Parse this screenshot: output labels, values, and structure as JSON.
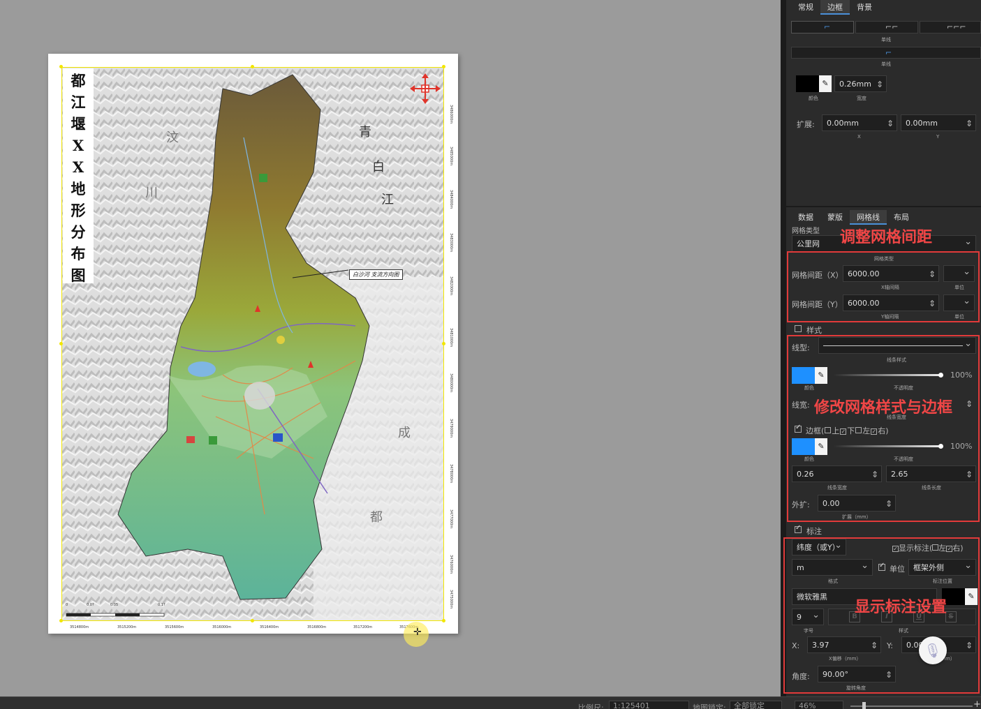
{
  "map": {
    "title_chars": [
      "都",
      "江",
      "堰",
      "X",
      "X",
      "地",
      "形",
      "分",
      "布",
      "图"
    ],
    "labels": {
      "wen": "汶",
      "chuan": "川",
      "qing": "青",
      "bai": "白",
      "jiang": "江",
      "cheng": "成",
      "du": "都"
    },
    "callout": "白沙河 支流方向图",
    "bottom_coords": [
      "3514800m",
      "3515200m",
      "3515600m",
      "3516000m",
      "3516400m",
      "3516800m",
      "3517200m",
      "3517600m"
    ],
    "right_coords": [
      "3486000m",
      "3485000m",
      "3484000m",
      "3483000m",
      "3482000m",
      "3481000m",
      "3480000m",
      "3479000m",
      "3478000m",
      "3477000m",
      "3476000m",
      "3475000m"
    ],
    "scale_ticks": [
      "0",
      "0.0?",
      "0.05",
      "0.1?"
    ]
  },
  "top_tabs": [
    "常规",
    "边框",
    "背景"
  ],
  "border": {
    "style1_label": "单线",
    "style2_label": "单线",
    "color": "#000000",
    "color_label": "颜色",
    "width_value": "0.26mm",
    "width_label": "宽度",
    "expand_label": "扩展:",
    "expand_x": "0.00mm",
    "expand_y": "0.00mm",
    "x_label": "X",
    "y_label": "Y"
  },
  "sub_tabs": [
    "数据",
    "蒙版",
    "网格线",
    "布局"
  ],
  "grid": {
    "type_label": "网格类型",
    "type_value": "公里网",
    "type_caption": "网格类型",
    "x_label": "网格间距（X）",
    "x_value": "6000.00",
    "x_caption": "X轴间隔",
    "y_label": "网格间距（Y）",
    "y_value": "6000.00",
    "y_caption": "Y轴间隔",
    "unit_caption": "单位"
  },
  "style": {
    "section_label": "样式",
    "line_type_label": "线型:",
    "line_type_caption": "线条样式",
    "line_color": "#1e90ff",
    "color_caption": "颜色",
    "opacity_caption": "不透明度",
    "opacity_value": "100%",
    "line_width_label": "线宽:",
    "line_width_caption": "线条宽度",
    "border_label": "边框(",
    "border_top": "上",
    "border_bottom": "下",
    "border_left": "左",
    "border_right": "右",
    "border_close": ")",
    "border_color": "#1e90ff",
    "border_opacity": "100%",
    "border_width": "0.26",
    "border_width_caption": "线条宽度",
    "border_length": "2.65",
    "border_length_caption": "线条长度",
    "outer_label": "外扩:",
    "outer_value": "0.00",
    "outer_caption": "扩展（mm）"
  },
  "annotation": {
    "section_label": "标注",
    "coord_select": "纬度（或Y）",
    "show_label": "显示标注(",
    "show_left": "左",
    "show_right": "右",
    "show_close": ")",
    "format_value": "m",
    "format_caption": "格式",
    "unit_label": "单位",
    "position_value": "框架外侧",
    "position_caption": "标注位置",
    "font_value": "微软雅黑",
    "font_color": "#000000",
    "size_value": "9",
    "size_caption": "字号",
    "style_caption": "样式",
    "bold": "B",
    "italic": "I",
    "underline": "U",
    "strike": "S",
    "x_label": "X:",
    "x_value": "3.97",
    "x_caption": "X偏移（mm）",
    "y_label": "Y:",
    "y_value": "0.00",
    "y_caption": "Y偏移（mm）",
    "angle_label": "角度:",
    "angle_value": "90.00°",
    "angle_caption": "旋转角度"
  },
  "overlays": {
    "grid_spacing": "调整网格间距",
    "grid_style": "修改网格样式与边框",
    "annotation": "显示标注设置"
  },
  "statusbar": {
    "scale_label": "比例尺:",
    "scale_value": "1:125401",
    "lock_label": "地图锁定:",
    "lock_value": "全部锁定",
    "zoom_value": "46%"
  }
}
